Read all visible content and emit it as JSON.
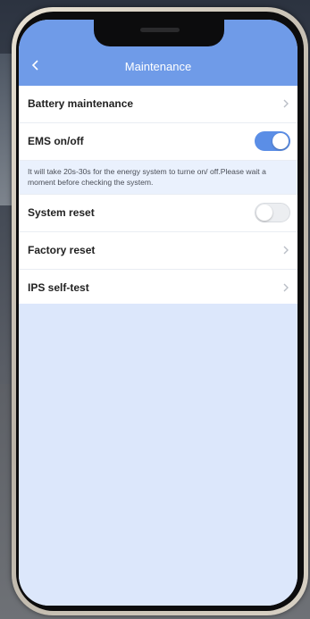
{
  "header": {
    "title": "Maintenance",
    "back_icon": "chevron-left-icon"
  },
  "rows": {
    "battery": {
      "label": "Battery maintenance"
    },
    "ems": {
      "label": "EMS on/off",
      "enabled": true
    },
    "note": {
      "text": "It will take 20s-30s for the energy system to turne on/ off.Please wait a moment before checking the system."
    },
    "system_reset": {
      "label": "System reset",
      "enabled": false
    },
    "factory_reset": {
      "label": "Factory reset"
    },
    "ips_self_test": {
      "label": "IPS self-test"
    }
  },
  "colors": {
    "header": "#6f9be8",
    "toggle_on": "#5b8ee6",
    "screen_bg": "#dee8fb"
  }
}
